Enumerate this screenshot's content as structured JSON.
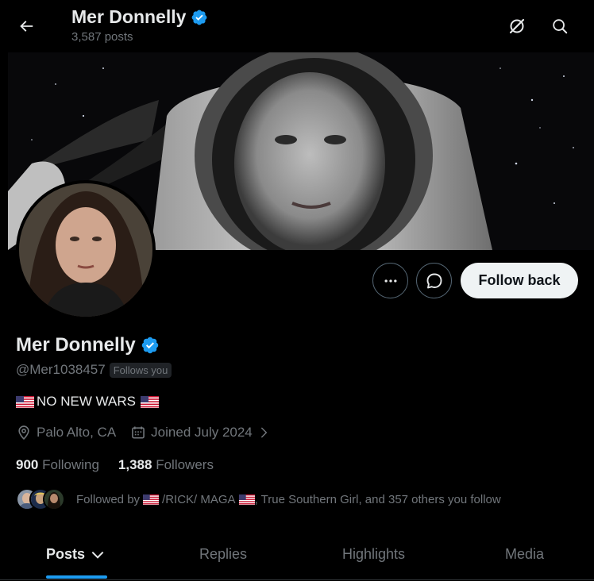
{
  "header": {
    "title": "Mer Donnelly",
    "posts_count": "3,587 posts"
  },
  "profile": {
    "name": "Mer Donnelly",
    "handle": "@Mer1038457",
    "follows_you": "Follows you",
    "bio_text": "NO NEW WARS",
    "location": "Palo Alto, CA",
    "joined": "Joined July 2024",
    "following_count": "900",
    "following_label": "Following",
    "followers_count": "1,388",
    "followers_label": "Followers",
    "followed_by_prefix": "Followed by",
    "followed_by_name1": "/RICK/ MAGA",
    "followed_by_rest": ", True Southern Girl, and 357 others you follow"
  },
  "actions": {
    "follow_back": "Follow back"
  },
  "tabs": [
    {
      "label": "Posts"
    },
    {
      "label": "Replies"
    },
    {
      "label": "Highlights"
    },
    {
      "label": "Media"
    }
  ],
  "colors": {
    "accent": "#1d9bf0",
    "verified": "#1d9bf0",
    "muted": "#71767b",
    "text": "#e7e9ea",
    "background": "#000000"
  }
}
